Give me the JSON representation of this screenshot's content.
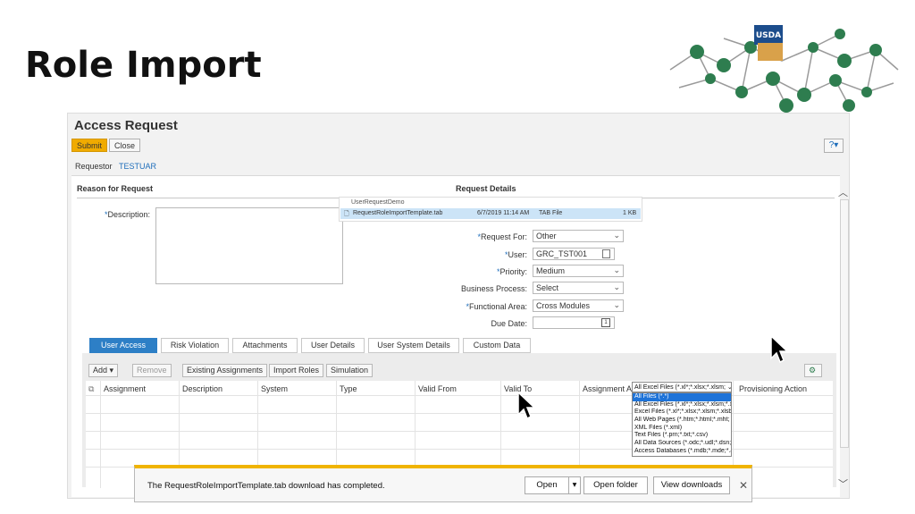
{
  "slide": {
    "title": "Role Import"
  },
  "logo": {
    "text": "USDA"
  },
  "app": {
    "title": "Access Request",
    "toolbar": {
      "submit_label": "Submit",
      "close_label": "Close"
    },
    "requestor": {
      "label": "Requestor",
      "value": "TESTUAR"
    }
  },
  "sections": {
    "reason": "Reason for Request",
    "details": "Request Details"
  },
  "form": {
    "description_label": "Description:",
    "request_for": {
      "label": "Request For:",
      "value": "Other"
    },
    "user": {
      "label": "User:",
      "value": "GRC_TST001"
    },
    "priority": {
      "label": "Priority:",
      "value": "Medium"
    },
    "business_process": {
      "label": "Business Process:",
      "value": "Select"
    },
    "functional_area": {
      "label": "Functional Area:",
      "value": "Cross Modules"
    },
    "due_date": {
      "label": "Due Date:",
      "value": ""
    }
  },
  "file_popup": {
    "folder": "UserRequestDemo",
    "file": {
      "name": "RequestRoleImportTemplate.tab",
      "date": "6/7/2019 11:14 AM",
      "type": "TAB File",
      "size": "1 KB"
    }
  },
  "tabs": [
    {
      "label": "User Access",
      "active": true
    },
    {
      "label": "Risk Violation"
    },
    {
      "label": "Attachments"
    },
    {
      "label": "User Details"
    },
    {
      "label": "User System Details"
    },
    {
      "label": "Custom Data"
    }
  ],
  "grid_toolbar": {
    "add": "Add",
    "remove": "Remove",
    "existing": "Existing Assignments",
    "import": "Import Roles",
    "simulation": "Simulation"
  },
  "grid": {
    "columns": [
      "Assignment",
      "Description",
      "System",
      "Type",
      "Valid From",
      "Valid To",
      "Assignment A",
      "Provisioning Action"
    ]
  },
  "file_type": {
    "selected": "All Excel Files (*.xl*;*.xlsx;*.xlsm;",
    "options": [
      "All Files (*.*)",
      "All Excel Files (*.xl*;*.xlsx;*.xlsm;*.xls",
      "Excel Files (*.xl*;*.xlsx;*.xlsm;*.xlsb;",
      "All Web Pages (*.htm;*.html;*.mht;",
      "XML Files (*.xml)",
      "Text Files (*.prn;*.txt;*.csv)",
      "All Data Sources (*.odc;*.udl;*.dsn;",
      "Access Databases (*.mdb;*.mde;*.a"
    ]
  },
  "download": {
    "message": "The RequestRoleImportTemplate.tab download has completed.",
    "open": "Open",
    "open_folder": "Open folder",
    "view_downloads": "View downloads"
  },
  "colors": {
    "accent": "#2d7fc6",
    "submit": "#f0ab00",
    "highlight": "#cce4f7"
  }
}
